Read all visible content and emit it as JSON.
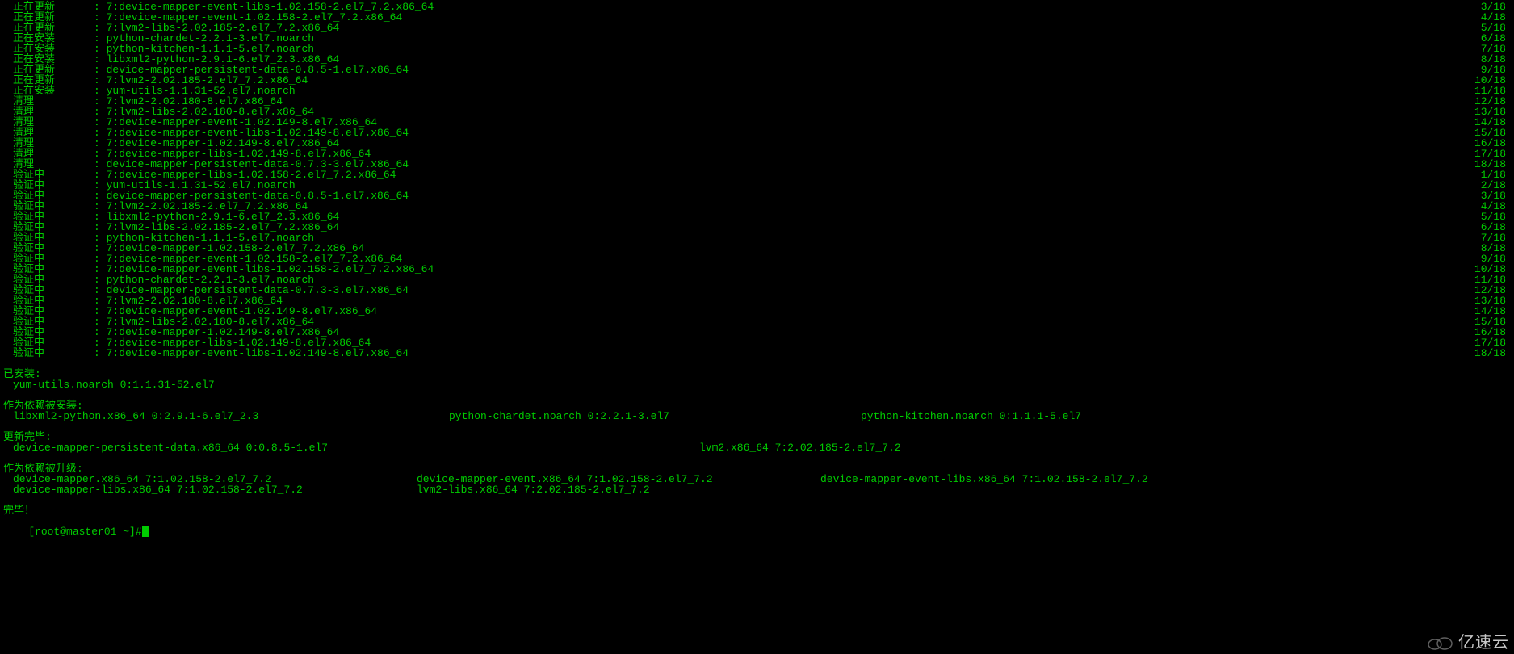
{
  "lines": [
    {
      "status": "正在更新",
      "pkg": ": 7:device-mapper-event-libs-1.02.158-2.el7_7.2.x86_64",
      "counter": "3/18"
    },
    {
      "status": "正在更新",
      "pkg": ": 7:device-mapper-event-1.02.158-2.el7_7.2.x86_64",
      "counter": "4/18"
    },
    {
      "status": "正在更新",
      "pkg": ": 7:lvm2-libs-2.02.185-2.el7_7.2.x86_64",
      "counter": "5/18"
    },
    {
      "status": "正在安装",
      "pkg": ": python-chardet-2.2.1-3.el7.noarch",
      "counter": "6/18"
    },
    {
      "status": "正在安装",
      "pkg": ": python-kitchen-1.1.1-5.el7.noarch",
      "counter": "7/18"
    },
    {
      "status": "正在安装",
      "pkg": ": libxml2-python-2.9.1-6.el7_2.3.x86_64",
      "counter": "8/18"
    },
    {
      "status": "正在更新",
      "pkg": ": device-mapper-persistent-data-0.8.5-1.el7.x86_64",
      "counter": "9/18"
    },
    {
      "status": "正在更新",
      "pkg": ": 7:lvm2-2.02.185-2.el7_7.2.x86_64",
      "counter": "10/18"
    },
    {
      "status": "正在安装",
      "pkg": ": yum-utils-1.1.31-52.el7.noarch",
      "counter": "11/18"
    },
    {
      "status": "清理",
      "pkg": ": 7:lvm2-2.02.180-8.el7.x86_64",
      "counter": "12/18"
    },
    {
      "status": "清理",
      "pkg": ": 7:lvm2-libs-2.02.180-8.el7.x86_64",
      "counter": "13/18"
    },
    {
      "status": "清理",
      "pkg": ": 7:device-mapper-event-1.02.149-8.el7.x86_64",
      "counter": "14/18"
    },
    {
      "status": "清理",
      "pkg": ": 7:device-mapper-event-libs-1.02.149-8.el7.x86_64",
      "counter": "15/18"
    },
    {
      "status": "清理",
      "pkg": ": 7:device-mapper-1.02.149-8.el7.x86_64",
      "counter": "16/18"
    },
    {
      "status": "清理",
      "pkg": ": 7:device-mapper-libs-1.02.149-8.el7.x86_64",
      "counter": "17/18"
    },
    {
      "status": "清理",
      "pkg": ": device-mapper-persistent-data-0.7.3-3.el7.x86_64",
      "counter": "18/18"
    },
    {
      "status": "验证中",
      "pkg": ": 7:device-mapper-libs-1.02.158-2.el7_7.2.x86_64",
      "counter": "1/18"
    },
    {
      "status": "验证中",
      "pkg": ": yum-utils-1.1.31-52.el7.noarch",
      "counter": "2/18"
    },
    {
      "status": "验证中",
      "pkg": ": device-mapper-persistent-data-0.8.5-1.el7.x86_64",
      "counter": "3/18"
    },
    {
      "status": "验证中",
      "pkg": ": 7:lvm2-2.02.185-2.el7_7.2.x86_64",
      "counter": "4/18"
    },
    {
      "status": "验证中",
      "pkg": ": libxml2-python-2.9.1-6.el7_2.3.x86_64",
      "counter": "5/18"
    },
    {
      "status": "验证中",
      "pkg": ": 7:lvm2-libs-2.02.185-2.el7_7.2.x86_64",
      "counter": "6/18"
    },
    {
      "status": "验证中",
      "pkg": ": python-kitchen-1.1.1-5.el7.noarch",
      "counter": "7/18"
    },
    {
      "status": "验证中",
      "pkg": ": 7:device-mapper-1.02.158-2.el7_7.2.x86_64",
      "counter": "8/18"
    },
    {
      "status": "验证中",
      "pkg": ": 7:device-mapper-event-1.02.158-2.el7_7.2.x86_64",
      "counter": "9/18"
    },
    {
      "status": "验证中",
      "pkg": ": 7:device-mapper-event-libs-1.02.158-2.el7_7.2.x86_64",
      "counter": "10/18"
    },
    {
      "status": "验证中",
      "pkg": ": python-chardet-2.2.1-3.el7.noarch",
      "counter": "11/18"
    },
    {
      "status": "验证中",
      "pkg": ": device-mapper-persistent-data-0.7.3-3.el7.x86_64",
      "counter": "12/18"
    },
    {
      "status": "验证中",
      "pkg": ": 7:lvm2-2.02.180-8.el7.x86_64",
      "counter": "13/18"
    },
    {
      "status": "验证中",
      "pkg": ": 7:device-mapper-event-1.02.149-8.el7.x86_64",
      "counter": "14/18"
    },
    {
      "status": "验证中",
      "pkg": ": 7:lvm2-libs-2.02.180-8.el7.x86_64",
      "counter": "15/18"
    },
    {
      "status": "验证中",
      "pkg": ": 7:device-mapper-1.02.149-8.el7.x86_64",
      "counter": "16/18"
    },
    {
      "status": "验证中",
      "pkg": ": 7:device-mapper-libs-1.02.149-8.el7.x86_64",
      "counter": "17/18"
    },
    {
      "status": "验证中",
      "pkg": ": 7:device-mapper-event-libs-1.02.149-8.el7.x86_64",
      "counter": "18/18"
    }
  ],
  "sections": {
    "installed_header": "已安装:",
    "installed_item": "yum-utils.noarch 0:1.1.31-52.el7",
    "dep_installed_header": "作为依赖被安装:",
    "dep_installed": {
      "c1": "libxml2-python.x86_64 0:2.9.1-6.el7_2.3",
      "c2": "python-chardet.noarch 0:2.2.1-3.el7",
      "c3": "python-kitchen.noarch 0:1.1.1-5.el7"
    },
    "updated_header": "更新完毕:",
    "updated": {
      "c1": "device-mapper-persistent-data.x86_64 0:0.8.5-1.el7",
      "c2": "lvm2.x86_64 7:2.02.185-2.el7_7.2"
    },
    "dep_upgraded_header": "作为依赖被升级:",
    "dep_upgraded_row1": {
      "c1": "device-mapper.x86_64 7:1.02.158-2.el7_7.2",
      "c2": "device-mapper-event.x86_64 7:1.02.158-2.el7_7.2",
      "c3": "device-mapper-event-libs.x86_64 7:1.02.158-2.el7_7.2"
    },
    "dep_upgraded_row2": {
      "c1": "device-mapper-libs.x86_64 7:1.02.158-2.el7_7.2",
      "c2": "lvm2-libs.x86_64 7:2.02.185-2.el7_7.2",
      "c3": ""
    },
    "done": "完毕！",
    "prompt": "[root@master01 ~]#"
  },
  "watermark": "亿速云"
}
